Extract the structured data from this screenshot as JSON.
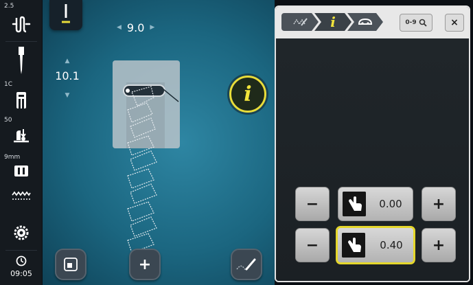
{
  "sidebar": {
    "tension_value": "2.5",
    "foot_label": "1C",
    "bobbin_value": "50",
    "width_limit": "9mm",
    "clock_time": "09:05"
  },
  "stage": {
    "stitch_width": "9.0",
    "stitch_length": "10.1",
    "info_glyph": "i"
  },
  "panel": {
    "search_label": "0-9",
    "close_label": "×",
    "info_crumb_glyph": "i",
    "controls": [
      {
        "minus": "−",
        "value": "0.00",
        "plus": "+"
      },
      {
        "minus": "−",
        "value": "0.40",
        "plus": "+",
        "selected": true
      }
    ]
  },
  "bottom_bar": {
    "plus_label": "+"
  },
  "colors": {
    "accent_yellow": "#e8dc3a",
    "stage_blue": "#1b6680",
    "sidebar_dark": "#151a1f"
  }
}
